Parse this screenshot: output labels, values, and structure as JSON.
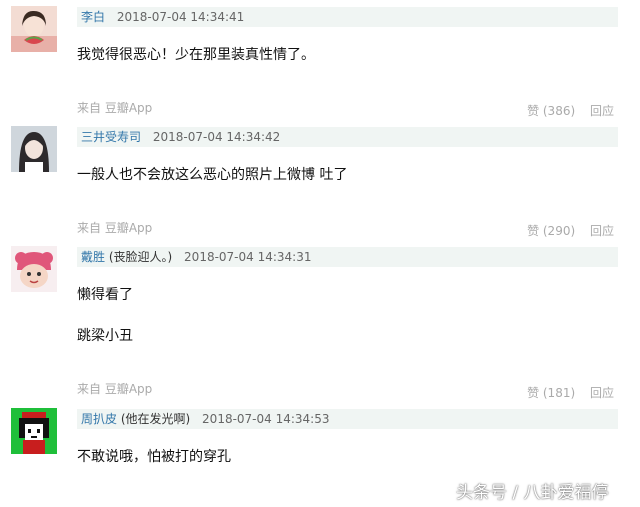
{
  "comments": [
    {
      "user": "李白",
      "note": "",
      "time": "2018-07-04 14:34:41",
      "lines": [
        "我觉得很恶心！少在那里装真性情了。"
      ],
      "source": "来自 豆瓣App",
      "likes": "赞 (386)",
      "reply": "回应"
    },
    {
      "user": "三井受寿司",
      "note": "",
      "time": "2018-07-04 14:34:42",
      "lines": [
        "一般人也不会放这么恶心的照片上微博 吐了"
      ],
      "source": "来自 豆瓣App",
      "likes": "赞 (290)",
      "reply": "回应"
    },
    {
      "user": "戴胜",
      "note": "(丧脸迎人。)",
      "time": "2018-07-04 14:34:31",
      "lines": [
        "懒得看了",
        "跳梁小丑"
      ],
      "source": "来自 豆瓣App",
      "likes": "赞 (181)",
      "reply": "回应"
    },
    {
      "user": "周扒皮",
      "note": "(他在发光啊)",
      "time": "2018-07-04 14:34:53",
      "lines": [
        "不敢说哦，怕被打的穿孔"
      ],
      "source": "",
      "likes": "",
      "reply": ""
    }
  ],
  "watermark": "头条号 / 八卦爱福停"
}
